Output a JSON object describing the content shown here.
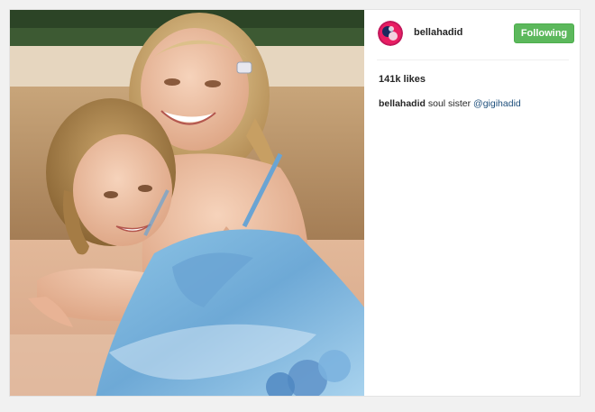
{
  "post": {
    "author": {
      "username": "bellahadid",
      "avatar_icon": "profile-avatar-icon"
    },
    "follow_button": {
      "label": "Following",
      "color": "#5cb85c"
    },
    "likes": "141k likes",
    "caption": {
      "username": "bellahadid",
      "text": "soul sister",
      "mention": "@gigihadid"
    },
    "colors": {
      "mention": "#1e4f7c",
      "background": "#f1f1f1"
    }
  }
}
